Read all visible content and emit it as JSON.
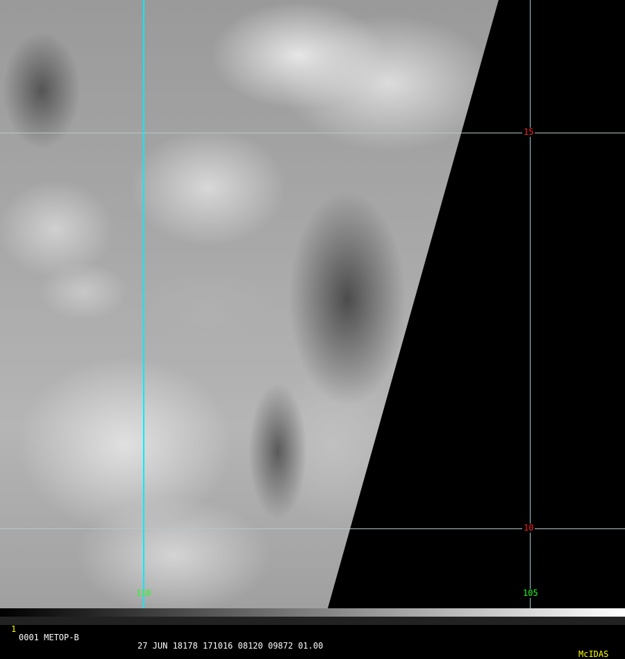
{
  "grid": {
    "lat_labels": [
      "15",
      "10"
    ],
    "lon_labels": [
      "110",
      "105"
    ],
    "colors": {
      "lat_label": "#ff2020",
      "lon_label": "#20ff20",
      "grid_line": "#00e5ee"
    }
  },
  "footer": {
    "frame": "1",
    "info_left": "0001 METOP-B",
    "info_mid": "27 JUN 18178 171016 08120 09872 01.00",
    "brand": "McIDAS"
  }
}
